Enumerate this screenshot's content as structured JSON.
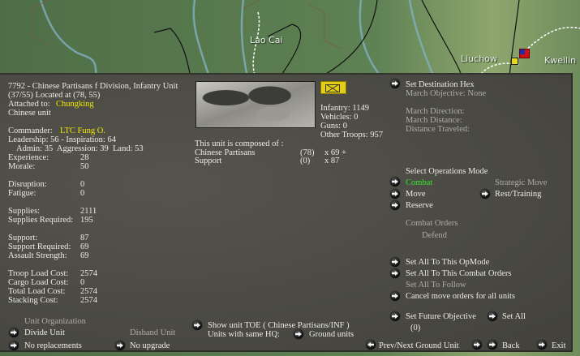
{
  "map": {
    "labels": [
      "Lao Cai",
      "Liuchow",
      "Kweilin"
    ]
  },
  "unit": {
    "title": "7792 - Chinese Partisans f Division, Infantry Unit",
    "location": "(37/55) Located at (78, 55)",
    "attached_label": "Attached to:",
    "attached_value": "Chungking",
    "nationality": "Chinese unit",
    "commander_label": "Commander:",
    "commander_value": "LTC Fung O.",
    "leadership": "Leadership: 56 - Inspiration: 64",
    "ratings": "Admin: 35  Aggression: 39  Land: 53",
    "stats": [
      {
        "label": "Experience:",
        "value": "28"
      },
      {
        "label": "Morale:",
        "value": "50"
      },
      {
        "label": "Disruption:",
        "value": "0"
      },
      {
        "label": "Fatigue:",
        "value": "0"
      },
      {
        "label": "Supplies:",
        "value": "2111"
      },
      {
        "label": "Supplies Required:",
        "value": "195"
      },
      {
        "label": "Support:",
        "value": "87"
      },
      {
        "label": "Support Required:",
        "value": "69"
      },
      {
        "label": "Assault Strength:",
        "value": "69"
      },
      {
        "label": "Troop Load Cost:",
        "value": "2574"
      },
      {
        "label": "Cargo Load Cost:",
        "value": "0"
      },
      {
        "label": "Total Load Cost:",
        "value": "2574"
      },
      {
        "label": "Stacking Cost:",
        "value": "2574"
      }
    ]
  },
  "organization": {
    "header": "Unit Organization",
    "divide": "Divide Unit",
    "disband": "Disband Unit",
    "replacements": "No replacements",
    "upgrade": "No upgrade"
  },
  "composition": {
    "infantry": "Infantry: 1149",
    "vehicles": "Vehicles: 0",
    "guns": "Guns: 0",
    "other": "Other Troops: 957",
    "header": "This unit is composed of :",
    "rows": [
      {
        "name": "Chinese Partisans",
        "count": "(78)",
        "qty": "x 69 +"
      },
      {
        "name": "Support",
        "count": "(0)",
        "qty": "x 87"
      }
    ]
  },
  "toe": {
    "show": "Show unit TOE ( Chinese Partisans/INF )",
    "same_hq": "Units with same HQ:",
    "ground": "Ground units"
  },
  "march": {
    "set_dest": "Set Destination Hex",
    "objective": "March Objective: None",
    "direction": "March Direction:",
    "distance": "March Distance:",
    "traveled": "Distance Traveled:"
  },
  "ops": {
    "header": "Select Operations Mode",
    "combat": "Combat",
    "move": "Move",
    "reserve": "Reserve",
    "strategic": "Strategic Move",
    "rest": "Rest/Training",
    "orders_header": "Combat Orders",
    "orders_value": "Defend"
  },
  "setall": {
    "opmode": "Set All To This OpMode",
    "combat_orders": "Set All To This Combat Orders",
    "follow": "Set All To Follow",
    "cancel": "Cancel move orders for all units",
    "future": "Set Future Objective",
    "set_all": "Set All",
    "future_value": "(0)"
  },
  "nav": {
    "prevnext": "Prev/Next Ground Unit",
    "back": "Back",
    "exit": "Exit"
  }
}
